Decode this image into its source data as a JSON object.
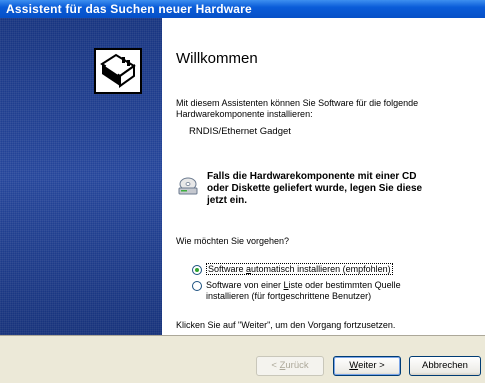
{
  "window": {
    "title": "Assistent für das Suchen neuer Hardware"
  },
  "main": {
    "heading": "Willkommen",
    "intro_line1": "Mit diesem Assistenten können Sie Software für die folgende",
    "intro_line2": "Hardwarekomponente installieren:",
    "device_name": "RNDIS/Ethernet Gadget",
    "cd_note_line1": "Falls die Hardwarekomponente mit einer CD",
    "cd_note_line2": "oder Diskette geliefert wurde, legen Sie diese",
    "cd_note_line3": "jetzt ein.",
    "question": "Wie möchten Sie vorgehen?",
    "options": [
      {
        "label_pre": "Software ",
        "label_key": "a",
        "label_post": "utomatisch installieren (empfohlen)",
        "selected": true
      },
      {
        "label_line1_pre": "Software von einer ",
        "label_line1_key": "L",
        "label_line1_post": "iste oder bestimmten Quelle",
        "label_line2": "installieren (für fortgeschrittene Benutzer)",
        "selected": false
      }
    ],
    "continue_hint": "Klicken Sie auf \"Weiter\", um den Vorgang fortzusetzen."
  },
  "buttons": {
    "back": {
      "pre": "< ",
      "key": "Z",
      "post": "urück"
    },
    "next": {
      "key": "W",
      "post": "eiter >"
    },
    "cancel": "Abbrechen"
  },
  "icons": {
    "hardware": "hardware-card-icon",
    "cd": "cd-drive-icon"
  },
  "colors": {
    "titlebar": "#0a5cd8",
    "sidebar": "#1c3e97",
    "radio_dot": "#31a32f"
  }
}
